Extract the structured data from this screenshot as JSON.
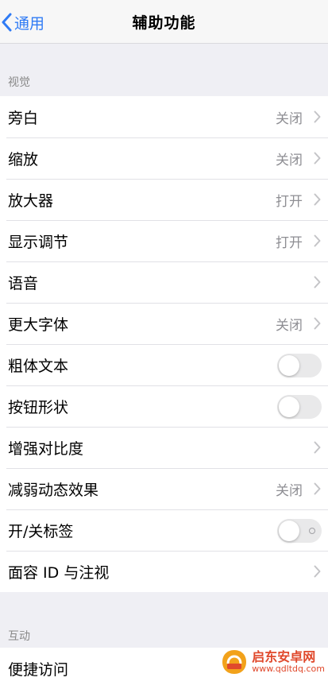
{
  "nav": {
    "back_label": "通用",
    "title": "辅助功能"
  },
  "sections": [
    {
      "header": "视觉"
    },
    {
      "header": "互动"
    }
  ],
  "vision_items": [
    {
      "label": "旁白",
      "value": "关闭",
      "control": "chevron"
    },
    {
      "label": "缩放",
      "value": "关闭",
      "control": "chevron"
    },
    {
      "label": "放大器",
      "value": "打开",
      "control": "chevron"
    },
    {
      "label": "显示调节",
      "value": "打开",
      "control": "chevron"
    },
    {
      "label": "语音",
      "value": "",
      "control": "chevron"
    },
    {
      "label": "更大字体",
      "value": "关闭",
      "control": "chevron"
    },
    {
      "label": "粗体文本",
      "value": "",
      "control": "toggle",
      "on": false
    },
    {
      "label": "按钮形状",
      "value": "",
      "control": "toggle",
      "on": false
    },
    {
      "label": "增强对比度",
      "value": "",
      "control": "chevron"
    },
    {
      "label": "减弱动态效果",
      "value": "关闭",
      "control": "chevron"
    },
    {
      "label": "开/关标签",
      "value": "",
      "control": "toggle",
      "on": false
    },
    {
      "label": "面容 ID 与注视",
      "value": "",
      "control": "chevron"
    }
  ],
  "interaction_items": [
    {
      "label": "便捷访问",
      "value": "",
      "control": "chevron"
    }
  ],
  "watermark": {
    "title": "启东安卓网",
    "url": "www.qdltdq.com"
  },
  "colors": {
    "accent": "#2f7bf5",
    "background": "#efeff4",
    "watermark": "#e0492c"
  }
}
